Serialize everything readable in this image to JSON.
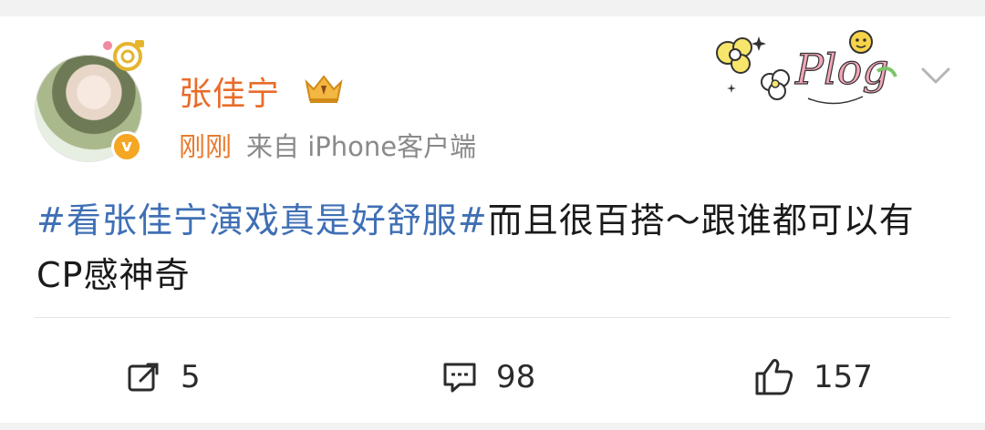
{
  "post": {
    "username": "张佳宁",
    "time": "刚刚",
    "source": "来自 iPhone客户端",
    "hashtag": "#看张佳宁演戏真是好舒服#",
    "text": "而且很百搭～跟谁都可以有CP感神奇",
    "badge_letter": "v",
    "decoration_label": "Plog"
  },
  "actions": {
    "share_count": "5",
    "comment_count": "98",
    "like_count": "157"
  },
  "colors": {
    "username": "#e86c2a",
    "hashtag": "#3f6fb5",
    "meta": "#8a8a8a"
  },
  "icons": [
    "share-icon",
    "comment-icon",
    "like-icon",
    "chevron-down-icon",
    "vip-crown-icon",
    "verified-badge-icon"
  ]
}
